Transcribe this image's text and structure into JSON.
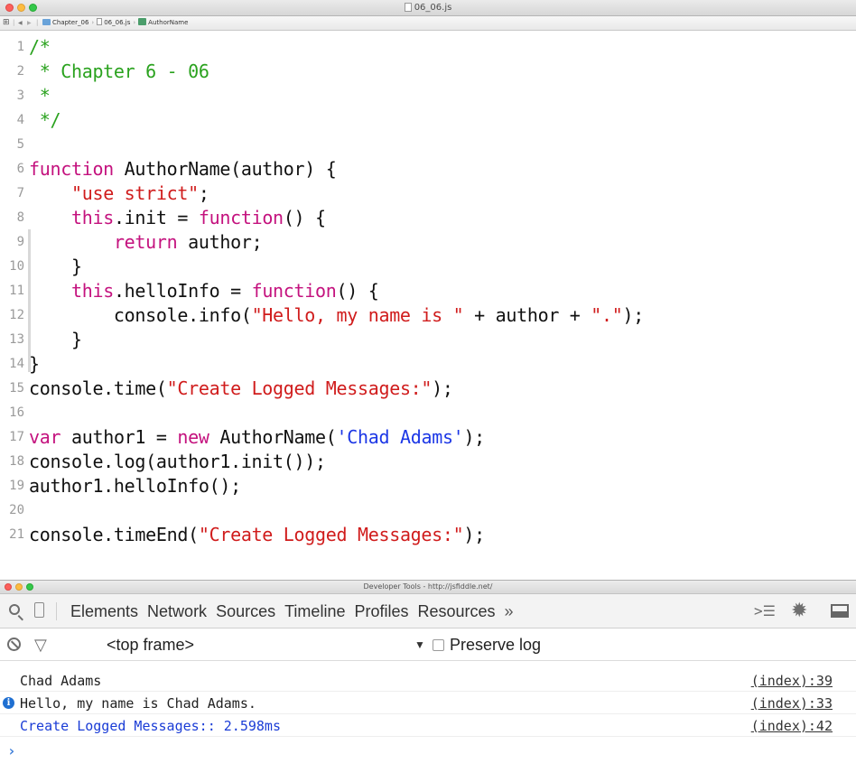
{
  "editor": {
    "title": "06_06.js",
    "breadcrumb": {
      "folder": "Chapter_06",
      "file": "06_06.js",
      "symbol": "AuthorName"
    },
    "lines": [
      {
        "num": "1",
        "parts": [
          [
            "c",
            "/*"
          ]
        ]
      },
      {
        "num": "2",
        "parts": [
          [
            "c",
            " * Chapter 6 - 06"
          ]
        ]
      },
      {
        "num": "3",
        "parts": [
          [
            "c",
            " *"
          ]
        ]
      },
      {
        "num": "4",
        "parts": [
          [
            "c",
            " */"
          ]
        ]
      },
      {
        "num": "5",
        "parts": []
      },
      {
        "num": "6",
        "parts": [
          [
            "k",
            "function"
          ],
          [
            "p",
            " AuthorName(author) {"
          ]
        ]
      },
      {
        "num": "7",
        "parts": [
          [
            "p",
            "    "
          ],
          [
            "s",
            "\"use strict\""
          ],
          [
            "p",
            ";"
          ]
        ]
      },
      {
        "num": "8",
        "parts": [
          [
            "p",
            "    "
          ],
          [
            "k",
            "this"
          ],
          [
            "p",
            ".init = "
          ],
          [
            "k",
            "function"
          ],
          [
            "p",
            "() {"
          ]
        ]
      },
      {
        "num": "9",
        "parts": [
          [
            "p",
            "        "
          ],
          [
            "k",
            "return"
          ],
          [
            "p",
            " author;"
          ]
        ]
      },
      {
        "num": "10",
        "parts": [
          [
            "p",
            "    }"
          ]
        ]
      },
      {
        "num": "11",
        "parts": [
          [
            "p",
            "    "
          ],
          [
            "k",
            "this"
          ],
          [
            "p",
            ".helloInfo = "
          ],
          [
            "k",
            "function"
          ],
          [
            "p",
            "() {"
          ]
        ]
      },
      {
        "num": "12",
        "parts": [
          [
            "p",
            "        console.info("
          ],
          [
            "s",
            "\"Hello, my name is \""
          ],
          [
            "p",
            " + author + "
          ],
          [
            "s",
            "\".\""
          ],
          [
            "p",
            ");"
          ]
        ]
      },
      {
        "num": "13",
        "parts": [
          [
            "p",
            "    }"
          ]
        ]
      },
      {
        "num": "14",
        "parts": [
          [
            "p",
            "}"
          ]
        ]
      },
      {
        "num": "15",
        "parts": [
          [
            "p",
            "console.time("
          ],
          [
            "s",
            "\"Create Logged Messages:\""
          ],
          [
            "p",
            ");"
          ]
        ]
      },
      {
        "num": "16",
        "parts": []
      },
      {
        "num": "17",
        "parts": [
          [
            "k",
            "var"
          ],
          [
            "p",
            " author1 = "
          ],
          [
            "k",
            "new"
          ],
          [
            "p",
            " AuthorName("
          ],
          [
            "b",
            "'Chad Adams'"
          ],
          [
            "p",
            ");"
          ]
        ]
      },
      {
        "num": "18",
        "parts": [
          [
            "p",
            "console.log(author1.init());"
          ]
        ]
      },
      {
        "num": "19",
        "parts": [
          [
            "p",
            "author1.helloInfo();"
          ]
        ]
      },
      {
        "num": "20",
        "parts": []
      },
      {
        "num": "21",
        "parts": [
          [
            "p",
            "console.timeEnd("
          ],
          [
            "s",
            "\"Create Logged Messages:\""
          ],
          [
            "p",
            ");"
          ]
        ]
      }
    ]
  },
  "devtools": {
    "title": "Developer Tools - http://jsfiddle.net/",
    "tabs": [
      "Elements",
      "Network",
      "Sources",
      "Timeline",
      "Profiles",
      "Resources"
    ],
    "more_tabs": "»",
    "frame_select": "<top frame>",
    "frame_arrow": "▼",
    "preserve_log": "Preserve log",
    "messages": [
      {
        "text": "Chad Adams",
        "source": "(index):39",
        "level": "log",
        "color": "#222222"
      },
      {
        "text": "Hello, my name is Chad Adams.",
        "source": "(index):33",
        "level": "info",
        "color": "#222222"
      },
      {
        "text": "Create Logged Messages:: 2.598ms",
        "source": "(index):42",
        "level": "log",
        "color": "#1a3cd6"
      }
    ],
    "prompt": "›"
  },
  "icons": {
    "editor_grid": "grid-icon",
    "search": "search-icon",
    "device": "device-mode-icon",
    "console_drawer": "console-drawer-icon",
    "settings": "gear-icon",
    "dock": "dock-icon",
    "clear": "clear-console-icon",
    "filter": "filter-icon",
    "info": "info-icon"
  },
  "colors": {
    "comment": "#2aa21e",
    "keyword": "#c4127e",
    "string": "#d01c1c",
    "string_single": "#1c37e6",
    "console_blue": "#1a3cd6",
    "info_icon": "#1f6fd1"
  }
}
